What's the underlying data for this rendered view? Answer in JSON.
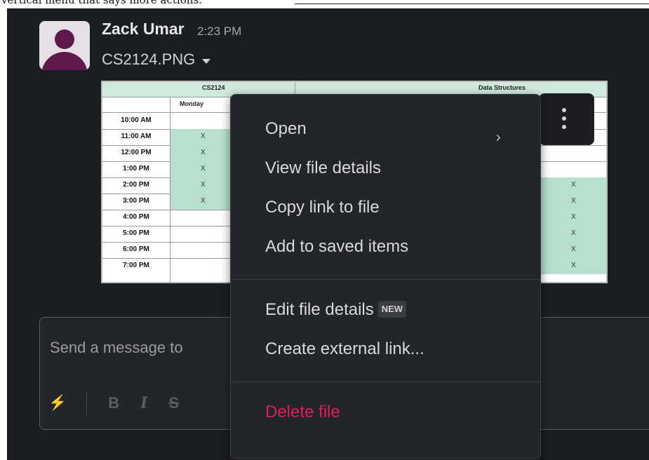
{
  "top_strip_text": "vertical menu that says more actions.",
  "message": {
    "sender": "Zack Umar",
    "time": "2:23 PM",
    "filename": "CS2124.PNG"
  },
  "preview": {
    "header_left": "CS2124",
    "header_right": "Data Structures",
    "day": "Monday",
    "times": [
      "10:00 AM",
      "11:00 AM",
      "12:00 PM",
      "1:00 PM",
      "2:00 PM",
      "3:00 PM",
      "4:00 PM",
      "5:00 PM",
      "6:00 PM",
      "7:00 PM"
    ],
    "mark": "X"
  },
  "composer": {
    "placeholder": "Send a message to",
    "toolbar": [
      "⚡",
      "B",
      "I",
      "S"
    ]
  },
  "menu": {
    "open": "Open",
    "view_details": "View file details",
    "copy_link": "Copy link to file",
    "add_saved": "Add to saved items",
    "edit_details": "Edit file details",
    "new_badge": "NEW",
    "create_external": "Create external link...",
    "delete": "Delete file"
  },
  "colors": {
    "accent_danger": "#e01e5a",
    "bg": "#1a1d21",
    "avatar": "#5e1a4c",
    "sheet_green": "#b9e0cc"
  }
}
